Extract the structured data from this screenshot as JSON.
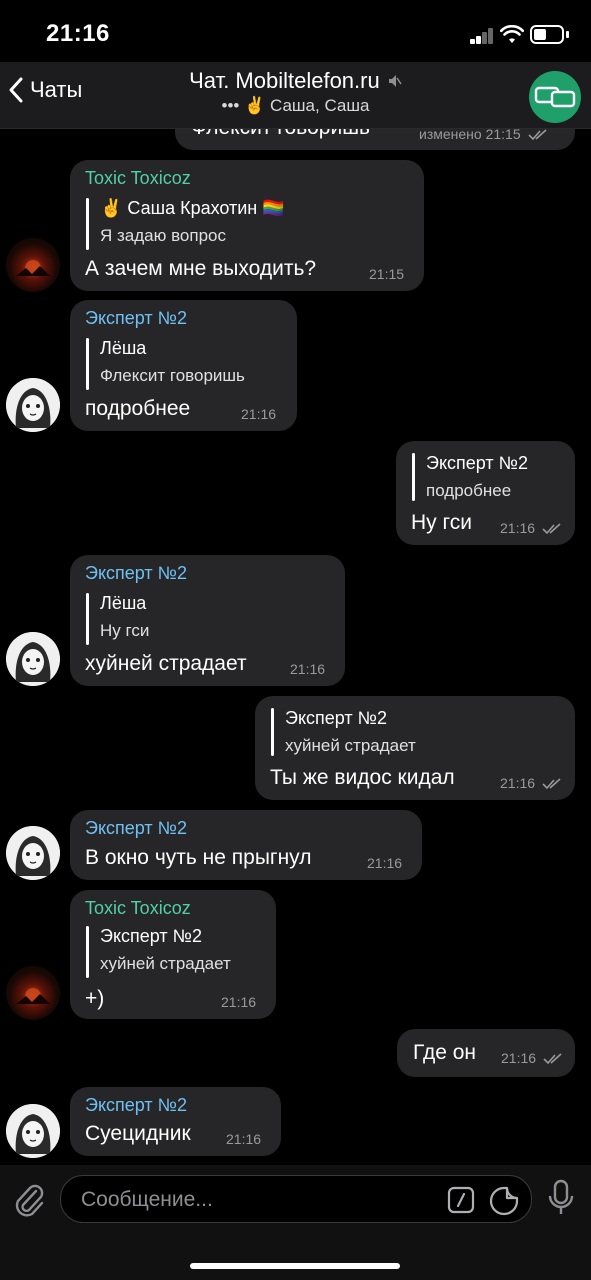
{
  "status": {
    "time": "21:16"
  },
  "header": {
    "back_label": "Чаты",
    "title": "Чат. Mobiltelefon.ru",
    "subtitle": "••• ✌️ Саша, Саша",
    "group_icon": "chat-bubbles-icon",
    "accent": "#1fa06a"
  },
  "colors": {
    "toxic_name": "#4fd0a8",
    "expert_name": "#6ec1f2",
    "bubble": "#262628",
    "background": "#000000"
  },
  "messages": [
    {
      "type": "out-partial",
      "text": "Флексит говоришь",
      "time": "изменено 21:15"
    },
    {
      "type": "in",
      "sender": "Toxic Toxicoz",
      "reply_name": "✌️ Саша Крахотин 🏳️‍🌈",
      "reply_text": "Я задаю вопрос",
      "text": "А зачем мне выходить?",
      "time": "21:15"
    },
    {
      "type": "in",
      "sender": "Эксперт №2",
      "reply_name": "Лёша",
      "reply_text": "Флексит говоришь",
      "text": "подробнее",
      "time": "21:16"
    },
    {
      "type": "out",
      "reply_name": "Эксперт №2",
      "reply_text": "подробнее",
      "text": "Ну гси",
      "time": "21:16"
    },
    {
      "type": "in",
      "sender": "Эксперт №2",
      "reply_name": "Лёша",
      "reply_text": "Ну гси",
      "text": "хуйней страдает",
      "time": "21:16"
    },
    {
      "type": "out",
      "reply_name": "Эксперт №2",
      "reply_text": "хуйней страдает",
      "text": "Ты же видос кидал",
      "time": "21:16"
    },
    {
      "type": "in",
      "sender": "Эксперт №2",
      "text": "В окно чуть не прыгнул",
      "time": "21:16"
    },
    {
      "type": "in",
      "sender": "Toxic Toxicoz",
      "reply_name": "Эксперт №2",
      "reply_text": "хуйней страдает",
      "text": "+)",
      "time": "21:16"
    },
    {
      "type": "out",
      "text": "Где он",
      "time": "21:16"
    },
    {
      "type": "in",
      "sender": "Эксперт №2",
      "text": "Суецидник",
      "time": "21:16"
    }
  ],
  "input": {
    "placeholder": "Сообщение..."
  }
}
